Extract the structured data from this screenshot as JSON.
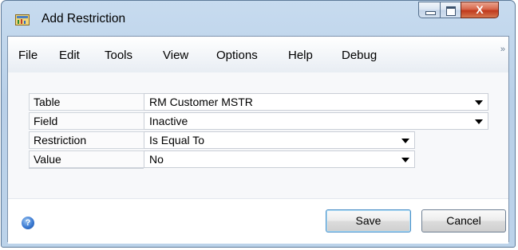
{
  "window": {
    "title": "Add Restriction",
    "close_glyph": "X"
  },
  "menu": {
    "items": [
      "File",
      "Edit",
      "Tools",
      "View",
      "Options",
      "Help",
      "Debug"
    ],
    "overflow_glyph": "»"
  },
  "form": {
    "rows": [
      {
        "label": "Table",
        "value": "RM Customer MSTR"
      },
      {
        "label": "Field",
        "value": "Inactive"
      },
      {
        "label": "Restriction",
        "value": "Is Equal To"
      },
      {
        "label": "Value",
        "value": "No"
      }
    ]
  },
  "footer": {
    "help_glyph": "?",
    "save_label": "Save",
    "cancel_label": "Cancel"
  },
  "icons": {
    "app": "dynamics-window-icon",
    "help": "help-icon",
    "dropdown": "dropdown-arrow-icon"
  }
}
